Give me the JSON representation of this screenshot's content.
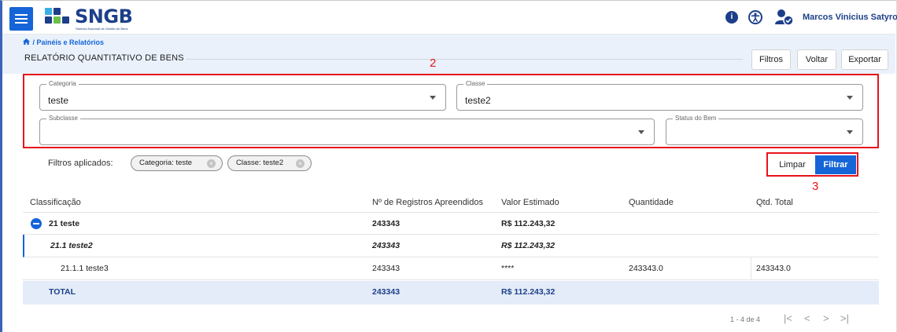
{
  "header": {
    "app_name": "SNGB",
    "app_subtitle": "Sistema Nacional de Gestão de Bens",
    "user_name": "Marcos Vinicius Satyro C...",
    "info_glyph": "i",
    "icons": [
      "menu-icon",
      "info-icon",
      "accessibility-icon",
      "user-verified-icon"
    ],
    "brand_color": "#1d3f8a",
    "accent_color": "#1565d8"
  },
  "breadcrumb": {
    "text": "/ Painéis e Relatórios"
  },
  "page": {
    "title": "RELATÓRIO QUANTITATIVO DE BENS",
    "buttons": {
      "filtros": "Filtros",
      "voltar": "Voltar",
      "exportar": "Exportar"
    }
  },
  "annotations": {
    "filters_box": "2",
    "filter_button_box": "3",
    "color": "#e8141a"
  },
  "filters": {
    "categoria": {
      "label": "Categoria",
      "value": "teste"
    },
    "classe": {
      "label": "Classe",
      "value": "teste2"
    },
    "subclasse": {
      "label": "Subclasse",
      "value": ""
    },
    "status": {
      "label": "Status do Bem",
      "value": ""
    },
    "applied_label": "Filtros aplicados:",
    "chips": [
      "Categoria: teste",
      "Classe: teste2"
    ],
    "clear_label": "Limpar",
    "apply_label": "Filtrar"
  },
  "table": {
    "columns": [
      "Classificação",
      "Nº de Registros Apreendidos",
      "Valor Estimado",
      "Quantidade",
      "Qtd. Total"
    ],
    "rows": [
      {
        "classificacao": "21 teste",
        "registros": "243343",
        "valor": "R$ 112.243,32",
        "quantidade": "",
        "total": ""
      },
      {
        "classificacao": "21.1 teste2",
        "registros": "243343",
        "valor": "R$ 112.243,32",
        "quantidade": "",
        "total": ""
      },
      {
        "classificacao": "21.1.1 teste3",
        "registros": "243343",
        "valor": "****",
        "quantidade": "243343.0",
        "total": "243343.0"
      }
    ],
    "total": {
      "label": "TOTAL",
      "registros": "243343",
      "valor": "R$ 112.243,32"
    }
  },
  "pagination": {
    "range": "1 - 4 de 4",
    "first": "|<",
    "prev": "<",
    "next": ">",
    "last": ">|"
  }
}
